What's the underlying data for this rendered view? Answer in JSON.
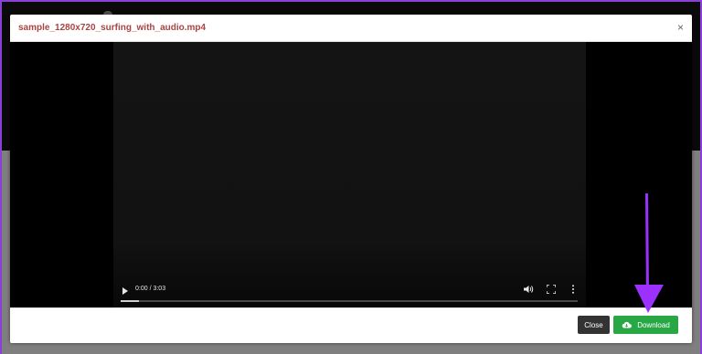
{
  "modal": {
    "title": "sample_1280x720_surfing_with_audio.mp4",
    "close_symbol": "×"
  },
  "video": {
    "time_display": "0:00 / 3:03",
    "progress_fraction": 0.04,
    "controls": [
      "play-icon",
      "volume-icon",
      "fullscreen-icon",
      "more-vert-icon"
    ]
  },
  "footer": {
    "close_label": "Close",
    "download_label": "Download",
    "download_icon": "cloud-download-icon"
  },
  "colors": {
    "title": "#a94442",
    "download_button": "#28a745",
    "close_button": "#333333",
    "annotation_arrow": "#9b30ff"
  }
}
